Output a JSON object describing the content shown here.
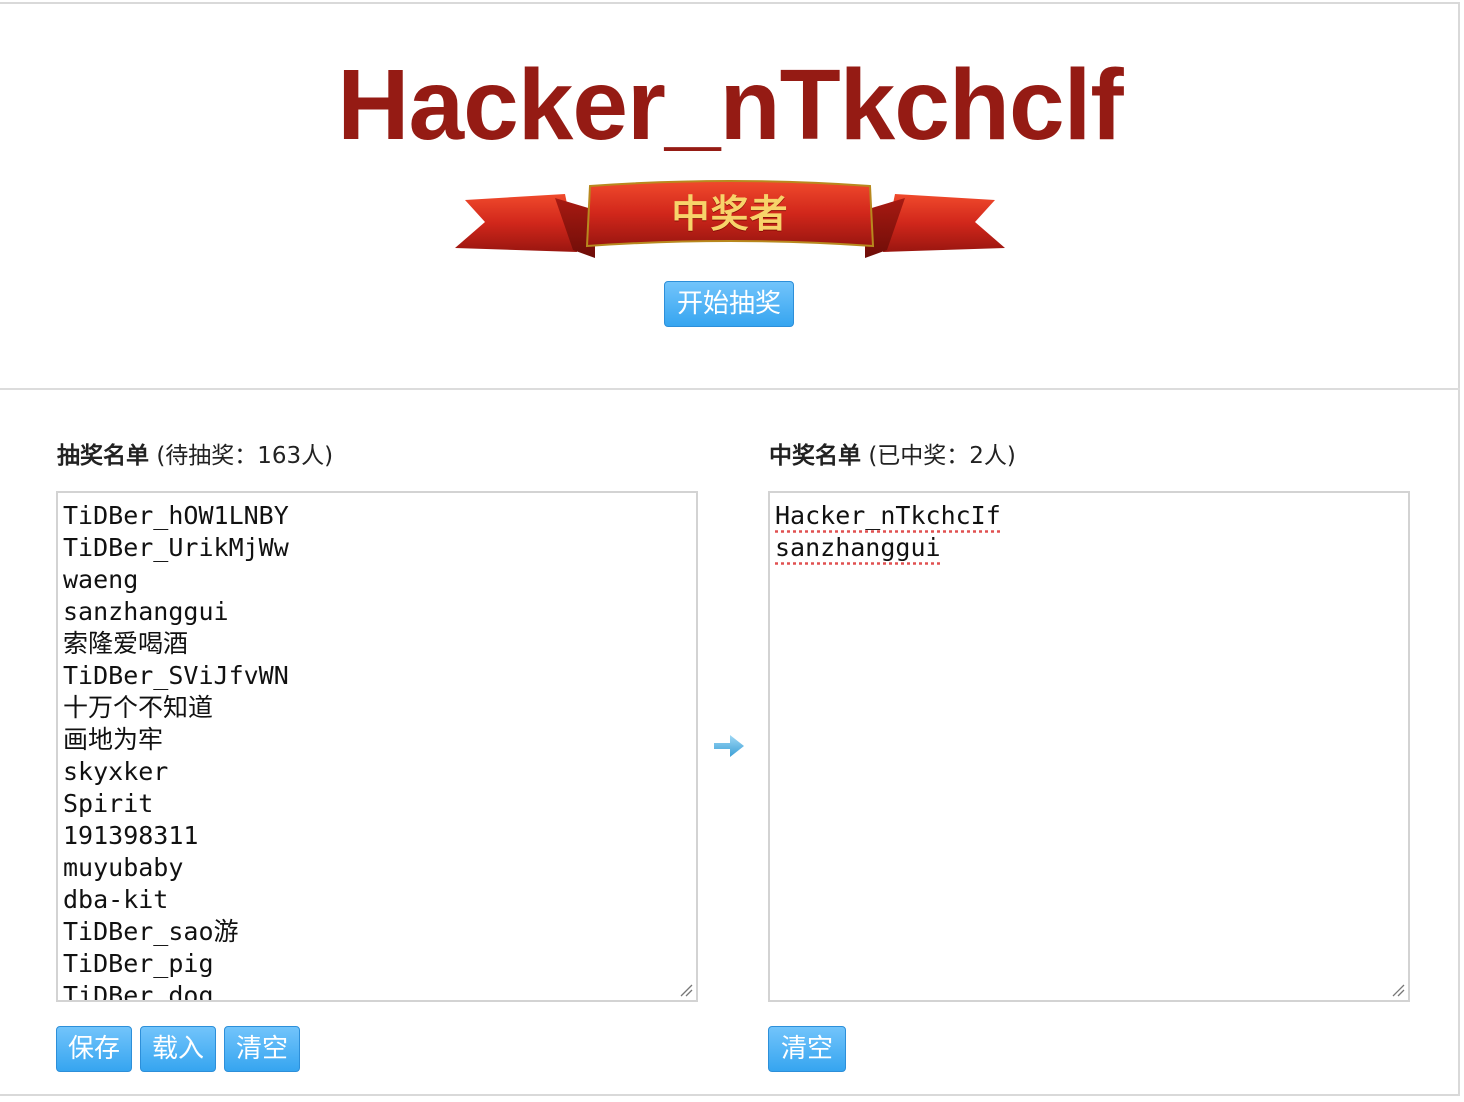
{
  "winner_display": "Hacker_nTkchclf",
  "banner_text": "中奖者",
  "start_button": "开始抽奖",
  "left_panel": {
    "title": "抽奖名单",
    "meta": "(待抽奖：163人)",
    "entries": [
      "TiDBer_hOW1LNBY",
      "TiDBer_UrikMjWw",
      "waeng",
      "sanzhanggui",
      "索隆爱喝酒",
      "TiDBer_SViJfvWN",
      "十万个不知道",
      "画地为牢",
      "skyxker",
      "Spirit",
      "191398311",
      "muyubaby",
      "dba-kit",
      "TiDBer_sao游",
      "TiDBer_pig",
      "TiDBer_dog"
    ],
    "buttons": {
      "save": "保存",
      "load": "载入",
      "clear": "清空"
    }
  },
  "right_panel": {
    "title": "中奖名单",
    "meta": "(已中奖：2人)",
    "entries": [
      "Hacker_nTkchcIf",
      "sanzhanggui"
    ],
    "buttons": {
      "clear": "清空"
    }
  },
  "colors": {
    "winner_text": "#951b14",
    "button_blue": "#36a5f0",
    "ribbon_red": "#d1271b",
    "banner_gold": "#f7d36a"
  },
  "icons": {
    "transfer_arrow": "arrow-right-icon",
    "resize": "resize-grip-icon"
  }
}
